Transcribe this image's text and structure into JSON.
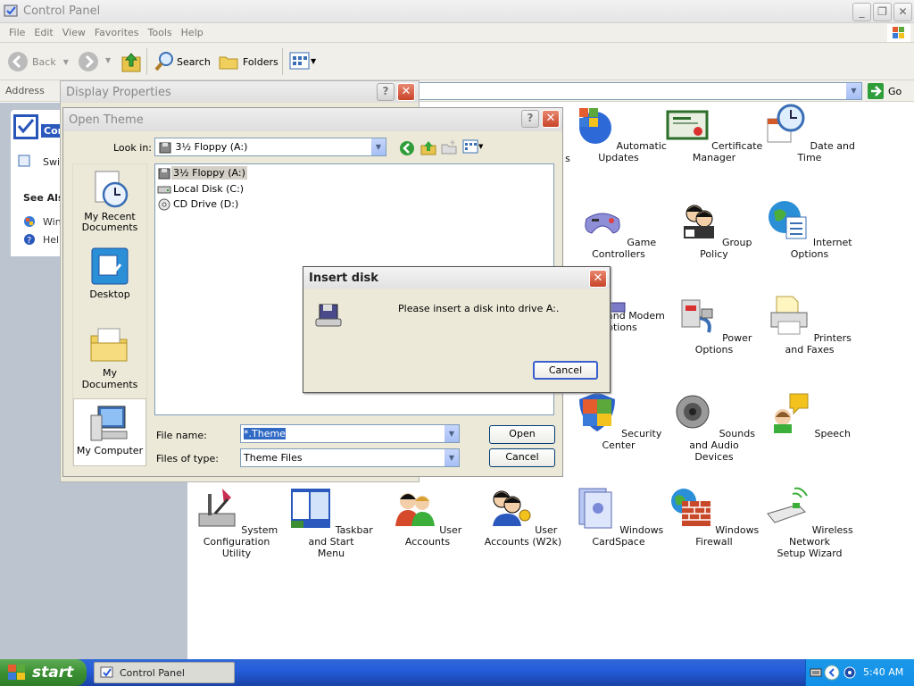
{
  "window": {
    "title": "Control Panel",
    "menu": [
      "File",
      "Edit",
      "View",
      "Favorites",
      "Tools",
      "Help"
    ],
    "toolbar": {
      "back": "Back",
      "search": "Search",
      "folders": "Folders"
    },
    "address": {
      "label": "Address",
      "go": "Go"
    }
  },
  "sidepane": {
    "truncated_title": "Con",
    "truncated_switch": "Swi",
    "see_also": "See Als",
    "see_also_items": [
      "Win",
      "Help"
    ]
  },
  "control_panel_items": [
    {
      "label": "s",
      "icon": "partial-icon"
    },
    {
      "label": "Automatic Updates",
      "icon": "windows-flag-globe-icon"
    },
    {
      "label": "Certificate Manager",
      "icon": "certificate-icon"
    },
    {
      "label": "Date and Time",
      "icon": "clock-calendar-icon"
    },
    {
      "label": "Game Controllers",
      "icon": "gamepad-icon"
    },
    {
      "label": "Group Policy",
      "icon": "group-policy-icon"
    },
    {
      "label": "Internet Options",
      "icon": "globe-document-icon"
    },
    {
      "label": "and Modem",
      "label2": "ptions",
      "icon": "modem-icon"
    },
    {
      "label": "Power Options",
      "icon": "power-plug-icon"
    },
    {
      "label": "Printers and Faxes",
      "icon": "printer-icon"
    },
    {
      "label": "Security Center",
      "icon": "shield-icon"
    },
    {
      "label": "Sounds and Audio",
      "label2": "Devices",
      "icon": "speaker-icon"
    },
    {
      "label": "Speech",
      "icon": "speech-icon"
    },
    {
      "label": "System Configuration",
      "label2": "Utility",
      "icon": "system-config-icon"
    },
    {
      "label": "Taskbar and Start",
      "label2": "Menu",
      "icon": "taskbar-icon"
    },
    {
      "label": "User Accounts",
      "icon": "users-icon"
    },
    {
      "label": "User Accounts (W2k)",
      "icon": "users-key-icon"
    },
    {
      "label": "Windows CardSpace",
      "icon": "cardspace-icon"
    },
    {
      "label": "Windows Firewall",
      "icon": "firewall-icon"
    },
    {
      "label": "Wireless Network",
      "label2": "Setup Wizard",
      "icon": "wireless-icon"
    }
  ],
  "display_properties": {
    "title": "Display Properties"
  },
  "open_theme": {
    "title": "Open Theme",
    "look_in_label": "Look in:",
    "look_in_value": "3½ Floppy (A:)",
    "places": [
      "My Recent Documents",
      "Desktop",
      "My Documents",
      "My Computer"
    ],
    "files": [
      "3½ Floppy (A:)",
      "Local Disk (C:)",
      "CD Drive (D:)"
    ],
    "file_name_label": "File name:",
    "file_name_value": "*.Theme",
    "file_type_label": "Files of type:",
    "file_type_value": "Theme Files",
    "open_button": "Open",
    "cancel_button": "Cancel"
  },
  "insert_disk": {
    "title": "Insert disk",
    "message": "Please insert a disk into drive A:.",
    "cancel_button": "Cancel"
  },
  "taskbar": {
    "start": "start",
    "task": "Control Panel",
    "clock": "5:40 AM"
  },
  "colors": {
    "taskbar_blue": "#245edb",
    "start_green": "#3c8f33",
    "close_red": "#c9432a",
    "selection": "#316ac5"
  }
}
